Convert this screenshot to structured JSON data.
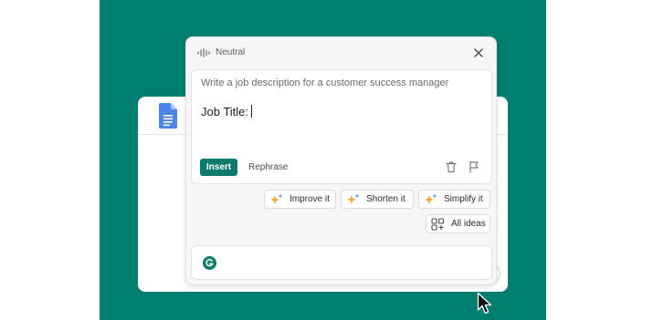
{
  "assistant": {
    "tone": "Neutral",
    "prompt": "Write a job description for a customer success manager",
    "draft": "Job Title:",
    "insert_label": "Insert",
    "rephrase_label": "Rephrase"
  },
  "suggestions": [
    {
      "label": "Improve it",
      "icon": "sparkle-icon"
    },
    {
      "label": "Shorten it",
      "icon": "sparkle-icon"
    },
    {
      "label": "Simplify it",
      "icon": "sparkle-icon"
    },
    {
      "label": "All ideas",
      "icon": "grid-plus-icon"
    }
  ],
  "colors": {
    "background": "#007f70",
    "accent": "#0b7b6c",
    "sparkle": "#f5a623",
    "docs_blue": "#4a86e8"
  }
}
